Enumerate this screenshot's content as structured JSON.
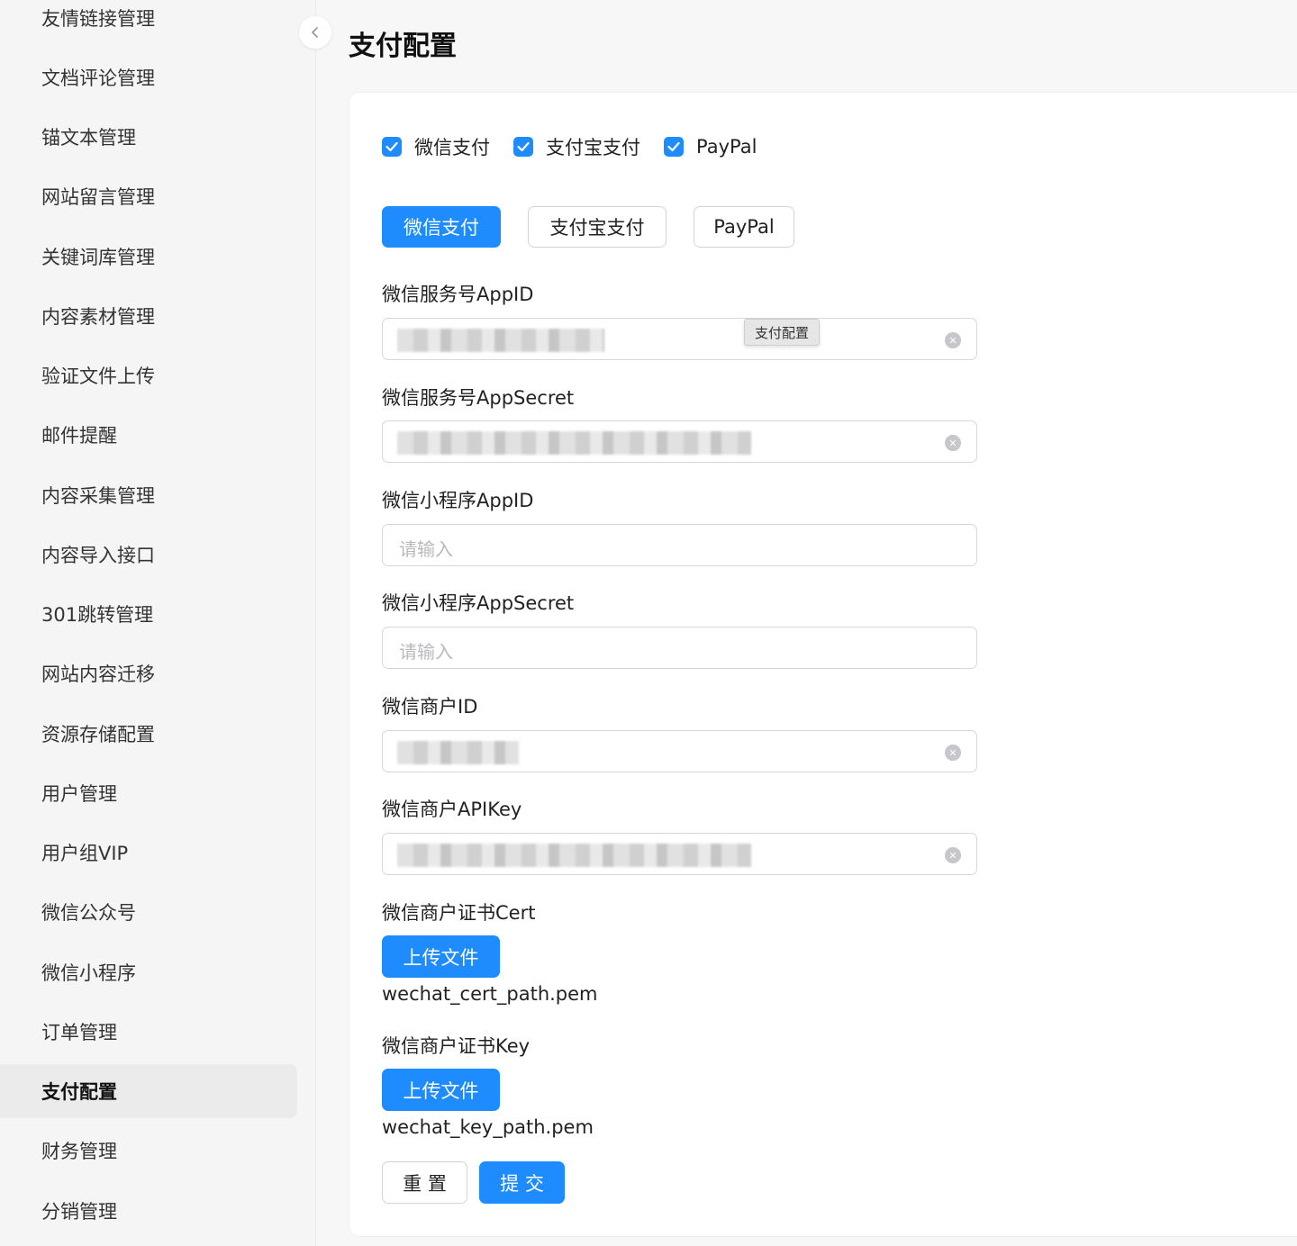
{
  "sidebar": {
    "items": [
      {
        "label": "友情链接管理"
      },
      {
        "label": "文档评论管理"
      },
      {
        "label": "锚文本管理"
      },
      {
        "label": "网站留言管理"
      },
      {
        "label": "关键词库管理"
      },
      {
        "label": "内容素材管理"
      },
      {
        "label": "验证文件上传"
      },
      {
        "label": "邮件提醒"
      },
      {
        "label": "内容采集管理"
      },
      {
        "label": "内容导入接口"
      },
      {
        "label": "301跳转管理"
      },
      {
        "label": "网站内容迁移"
      },
      {
        "label": "资源存储配置"
      },
      {
        "label": "用户管理"
      },
      {
        "label": "用户组VIP"
      },
      {
        "label": "微信公众号"
      },
      {
        "label": "微信小程序"
      },
      {
        "label": "订单管理"
      },
      {
        "label": "支付配置",
        "active": true
      },
      {
        "label": "财务管理"
      },
      {
        "label": "分销管理"
      }
    ],
    "collapse_icon": "chevron-left-icon"
  },
  "page": {
    "title": "支付配置"
  },
  "payment_methods": [
    {
      "label": "微信支付",
      "checked": true
    },
    {
      "label": "支付宝支付",
      "checked": true
    },
    {
      "label": "PayPal",
      "checked": true
    }
  ],
  "tabs": [
    {
      "label": "微信支付",
      "active": true
    },
    {
      "label": "支付宝支付",
      "active": false
    },
    {
      "label": "PayPal",
      "active": false
    }
  ],
  "form": {
    "appid_label": "微信服务号AppID",
    "appsecret_label": "微信服务号AppSecret",
    "mini_appid_label": "微信小程序AppID",
    "mini_appid_placeholder": "请输入",
    "mini_appsecret_label": "微信小程序AppSecret",
    "mini_appsecret_placeholder": "请输入",
    "mch_id_label": "微信商户ID",
    "mch_apikey_label": "微信商户APIKey",
    "cert_label": "微信商户证书Cert",
    "cert_upload_label": "上传文件",
    "cert_filename": "wechat_cert_path.pem",
    "key_label": "微信商户证书Key",
    "key_upload_label": "上传文件",
    "key_filename": "wechat_key_path.pem",
    "tooltip": "支付配置"
  },
  "actions": {
    "reset_label": "重 置",
    "submit_label": "提 交"
  },
  "colors": {
    "accent": "#1e8bff"
  }
}
